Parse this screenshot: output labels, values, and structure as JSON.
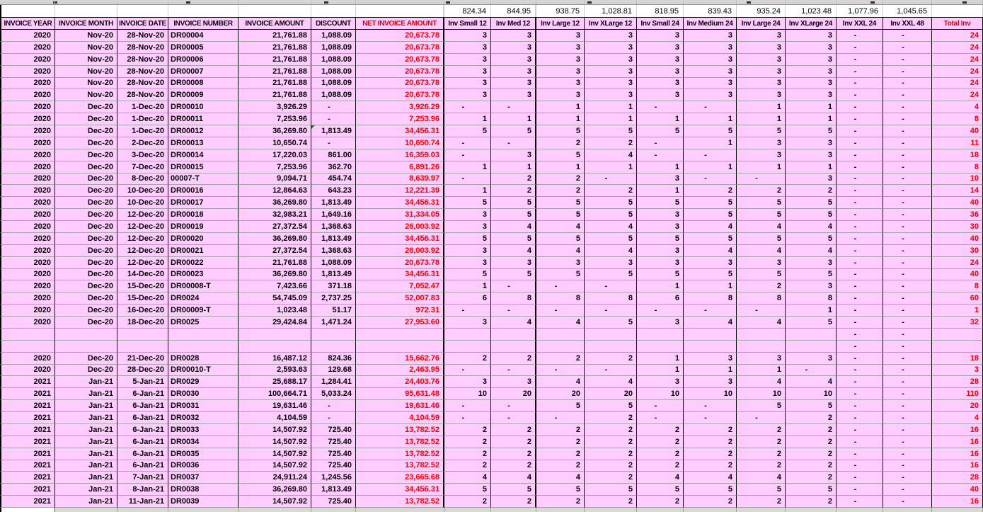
{
  "sheet": {
    "columns": [
      "INVOICE YEAR",
      "INVOICE MONTH",
      "INVOICE DATE",
      "INVOICE NUMBER",
      "INVOICE AMOUNT",
      "DISCOUNT",
      "NET INVOICE AMOUNT",
      "Inv Small 12",
      "Inv Med 12",
      "Inv Large 12",
      "Inv XLarge 12",
      "Inv Small 24",
      "Inv Medium 24",
      "Inv Large 24",
      "Inv XLarge 24",
      "Inv XXL 24",
      "Inv XXL 48",
      "Total Inv"
    ],
    "red_header_columns": [
      6,
      17
    ],
    "price_row": [
      "824.34",
      "844.95",
      "938.75",
      "1,028.81",
      "818.95",
      "839.43",
      "935.24",
      "1,023.48",
      "1,077.96",
      "1,045.65"
    ],
    "green_flag": {
      "row": 8,
      "col": 5
    },
    "rows": [
      [
        "2020",
        "Nov-20",
        "28-Nov-20",
        "DR00004",
        "21,761.88",
        "1,088.09",
        "20,673.78",
        "3",
        "3",
        "3",
        "3",
        "3",
        "3",
        "3",
        "3",
        "-",
        "-",
        "24"
      ],
      [
        "2020",
        "Nov-20",
        "28-Nov-20",
        "DR00005",
        "21,761.88",
        "1,088.09",
        "20,673.78",
        "3",
        "3",
        "3",
        "3",
        "3",
        "3",
        "3",
        "3",
        "-",
        "-",
        "24"
      ],
      [
        "2020",
        "Nov-20",
        "28-Nov-20",
        "DR00006",
        "21,761.88",
        "1,088.09",
        "20,673.78",
        "3",
        "3",
        "3",
        "3",
        "3",
        "3",
        "3",
        "3",
        "-",
        "-",
        "24"
      ],
      [
        "2020",
        "Nov-20",
        "28-Nov-20",
        "DR00007",
        "21,761.88",
        "1,088.09",
        "20,673.78",
        "3",
        "3",
        "3",
        "3",
        "3",
        "3",
        "3",
        "3",
        "-",
        "-",
        "24"
      ],
      [
        "2020",
        "Nov-20",
        "28-Nov-20",
        "DR00008",
        "21,761.88",
        "1,088.09",
        "20,673.78",
        "3",
        "3",
        "3",
        "3",
        "3",
        "3",
        "3",
        "3",
        "-",
        "-",
        "24"
      ],
      [
        "2020",
        "Nov-20",
        "28-Nov-20",
        "DR00009",
        "21,761.88",
        "1,088.09",
        "20,673.78",
        "3",
        "3",
        "3",
        "3",
        "3",
        "3",
        "3",
        "3",
        "-",
        "-",
        "24"
      ],
      [
        "2020",
        "Dec-20",
        "1-Dec-20",
        "DR00010",
        "3,926.29",
        "-",
        "3,926.29",
        "-",
        "-",
        "1",
        "1",
        "-",
        "-",
        "1",
        "1",
        "-",
        "-",
        "4"
      ],
      [
        "2020",
        "Dec-20",
        "1-Dec-20",
        "DR00011",
        "7,253.96",
        "-",
        "7,253.96",
        "1",
        "1",
        "1",
        "1",
        "1",
        "1",
        "1",
        "1",
        "-",
        "-",
        "8"
      ],
      [
        "2020",
        "Dec-20",
        "1-Dec-20",
        "DR00012",
        "36,269.80",
        "1,813.49",
        "34,456.31",
        "5",
        "5",
        "5",
        "5",
        "5",
        "5",
        "5",
        "5",
        "-",
        "-",
        "40"
      ],
      [
        "2020",
        "Dec-20",
        "2-Dec-20",
        "DR00013",
        "10,650.74",
        "-",
        "10,650.74",
        "-",
        "-",
        "2",
        "2",
        "-",
        "1",
        "3",
        "3",
        "-",
        "-",
        "11"
      ],
      [
        "2020",
        "Dec-20",
        "3-Dec-20",
        "DR00014",
        "17,220.03",
        "861.00",
        "16,359.03",
        "-",
        "3",
        "5",
        "4",
        "-",
        "-",
        "3",
        "3",
        "-",
        "-",
        "18"
      ],
      [
        "2020",
        "Dec-20",
        "7-Dec-20",
        "DR00015",
        "7,253.96",
        "362.70",
        "6,891.26",
        "1",
        "1",
        "1",
        "1",
        "1",
        "1",
        "1",
        "1",
        "-",
        "-",
        "8"
      ],
      [
        "2020",
        "Dec-20",
        "8-Dec-20",
        "00007-T",
        "9,094.71",
        "454.74",
        "8,639.97",
        "-",
        "2",
        "2",
        "-",
        "3",
        "-",
        "-",
        "3",
        "-",
        "-",
        "10"
      ],
      [
        "2020",
        "Dec-20",
        "10-Dec-20",
        "DR00016",
        "12,864.63",
        "643.23",
        "12,221.39",
        "1",
        "2",
        "2",
        "2",
        "1",
        "2",
        "2",
        "2",
        "-",
        "-",
        "14"
      ],
      [
        "2020",
        "Dec-20",
        "10-Dec-20",
        "DR00017",
        "36,269.80",
        "1,813.49",
        "34,456.31",
        "5",
        "5",
        "5",
        "5",
        "5",
        "5",
        "5",
        "5",
        "-",
        "-",
        "40"
      ],
      [
        "2020",
        "Dec-20",
        "12-Dec-20",
        "DR00018",
        "32,983.21",
        "1,649.16",
        "31,334.05",
        "3",
        "5",
        "5",
        "5",
        "3",
        "5",
        "5",
        "5",
        "-",
        "-",
        "36"
      ],
      [
        "2020",
        "Dec-20",
        "12-Dec-20",
        "DR00019",
        "27,372.54",
        "1,368.63",
        "26,003.92",
        "3",
        "4",
        "4",
        "4",
        "3",
        "4",
        "4",
        "4",
        "-",
        "-",
        "30"
      ],
      [
        "2020",
        "Dec-20",
        "12-Dec-20",
        "DR00020",
        "36,269.80",
        "1,813.49",
        "34,456.31",
        "5",
        "5",
        "5",
        "5",
        "5",
        "5",
        "5",
        "5",
        "-",
        "-",
        "40"
      ],
      [
        "2020",
        "Dec-20",
        "12-Dec-20",
        "DR00021",
        "27,372.54",
        "1,368.63",
        "26,003.92",
        "3",
        "4",
        "4",
        "4",
        "3",
        "4",
        "4",
        "4",
        "-",
        "-",
        "30"
      ],
      [
        "2020",
        "Dec-20",
        "12-Dec-20",
        "DR00022",
        "21,761.88",
        "1,088.09",
        "20,673.78",
        "3",
        "3",
        "3",
        "3",
        "3",
        "3",
        "3",
        "3",
        "-",
        "-",
        "24"
      ],
      [
        "2020",
        "Dec-20",
        "14-Dec-20",
        "DR00023",
        "36,269.80",
        "1,813.49",
        "34,456.31",
        "5",
        "5",
        "5",
        "5",
        "5",
        "5",
        "5",
        "5",
        "-",
        "-",
        "40"
      ],
      [
        "2020",
        "Dec-20",
        "15-Dec-20",
        "DR00008-T",
        "7,423.66",
        "371.18",
        "7,052.47",
        "1",
        "-",
        "-",
        "-",
        "1",
        "1",
        "2",
        "3",
        "-",
        "-",
        "8"
      ],
      [
        "2020",
        "Dec-20",
        "15-Dec-20",
        "DR0024",
        "54,745.09",
        "2,737.25",
        "52,007.83",
        "6",
        "8",
        "8",
        "8",
        "6",
        "8",
        "8",
        "8",
        "-",
        "-",
        "60"
      ],
      [
        "2020",
        "Dec-20",
        "16-Dec-20",
        "DR00009-T",
        "1,023.48",
        "51.17",
        "972.31",
        "-",
        "-",
        "-",
        "-",
        "-",
        "-",
        "-",
        "1",
        "-",
        "-",
        "1"
      ],
      [
        "2020",
        "Dec-20",
        "18-Dec-20",
        "DR0025",
        "29,424.84",
        "1,471.24",
        "27,953.60",
        "3",
        "4",
        "4",
        "5",
        "3",
        "4",
        "4",
        "5",
        "-",
        "-",
        "32"
      ],
      [
        "",
        "",
        "",
        "",
        "",
        "",
        "",
        "",
        "",
        "",
        "",
        "",
        "",
        "",
        "",
        "-",
        "-",
        ""
      ],
      [
        "",
        "",
        "",
        "",
        "",
        "",
        "",
        "",
        "",
        "",
        "",
        "",
        "",
        "",
        "",
        "-",
        "-",
        ""
      ],
      [
        "2020",
        "Dec-20",
        "21-Dec-20",
        "DR0028",
        "16,487.12",
        "824.36",
        "15,662.76",
        "2",
        "2",
        "2",
        "2",
        "1",
        "3",
        "3",
        "3",
        "-",
        "-",
        "18"
      ],
      [
        "2020",
        "Dec-20",
        "28-Dec-20",
        "DR00010-T",
        "2,593.63",
        "129.68",
        "2,463.95",
        "-",
        "-",
        "-",
        "-",
        "1",
        "1",
        "1",
        "-",
        "-",
        "-",
        "3"
      ],
      [
        "2021",
        "Jan-21",
        "5-Jan-21",
        "DR0029",
        "25,688.17",
        "1,284.41",
        "24,403.76",
        "3",
        "3",
        "4",
        "4",
        "3",
        "3",
        "4",
        "4",
        "-",
        "-",
        "28"
      ],
      [
        "2021",
        "Jan-21",
        "6-Jan-21",
        "DR0030",
        "100,664.71",
        "5,033.24",
        "95,631.48",
        "10",
        "20",
        "20",
        "20",
        "10",
        "10",
        "10",
        "10",
        "-",
        "-",
        "110"
      ],
      [
        "2021",
        "Jan-21",
        "6-Jan-21",
        "DR0031",
        "19,631.46",
        "-",
        "19,631.46",
        "-",
        "-",
        "5",
        "5",
        "-",
        "-",
        "5",
        "5",
        "-",
        "-",
        "20"
      ],
      [
        "2021",
        "Jan-21",
        "6-Jan-21",
        "DR0032",
        "4,104.59",
        "-",
        "4,104.59",
        "-",
        "-",
        "-",
        "2",
        "-",
        "-",
        "-",
        "2",
        "-",
        "-",
        "4"
      ],
      [
        "2021",
        "Jan-21",
        "6-Jan-21",
        "DR0033",
        "14,507.92",
        "725.40",
        "13,782.52",
        "2",
        "2",
        "2",
        "2",
        "2",
        "2",
        "2",
        "2",
        "-",
        "-",
        "16"
      ],
      [
        "2021",
        "Jan-21",
        "6-Jan-21",
        "DR0034",
        "14,507.92",
        "725.40",
        "13,782.52",
        "2",
        "2",
        "2",
        "2",
        "2",
        "2",
        "2",
        "2",
        "-",
        "-",
        "16"
      ],
      [
        "2021",
        "Jan-21",
        "6-Jan-21",
        "DR0035",
        "14,507.92",
        "725.40",
        "13,782.52",
        "2",
        "2",
        "2",
        "2",
        "2",
        "2",
        "2",
        "2",
        "-",
        "-",
        "16"
      ],
      [
        "2021",
        "Jan-21",
        "6-Jan-21",
        "DR0036",
        "14,507.92",
        "725.40",
        "13,782.52",
        "2",
        "2",
        "2",
        "2",
        "2",
        "2",
        "2",
        "2",
        "-",
        "-",
        "16"
      ],
      [
        "2021",
        "Jan-21",
        "7-Jan-21",
        "DR0037",
        "24,911.24",
        "1,245.56",
        "23,665.68",
        "4",
        "4",
        "4",
        "2",
        "4",
        "4",
        "4",
        "2",
        "-",
        "-",
        "28"
      ],
      [
        "2021",
        "Jan-21",
        "8-Jan-21",
        "DR0038",
        "36,269.80",
        "1,813.49",
        "34,456.31",
        "5",
        "5",
        "5",
        "5",
        "5",
        "5",
        "5",
        "5",
        "-",
        "-",
        "40"
      ],
      [
        "2021",
        "Jan-21",
        "11-Jan-21",
        "DR0039",
        "14,507.92",
        "725.40",
        "13,782.52",
        "2",
        "2",
        "2",
        "2",
        "2",
        "2",
        "2",
        "2",
        "-",
        "-",
        "16"
      ]
    ]
  },
  "colors": {
    "cell_bg": "#FFCCFF",
    "grid_line": "#A5A5A5",
    "cell_border": "#000000",
    "net_value_red": "#FF0000",
    "header_red": "#E00000",
    "flag_green": "#1E7E1E"
  }
}
